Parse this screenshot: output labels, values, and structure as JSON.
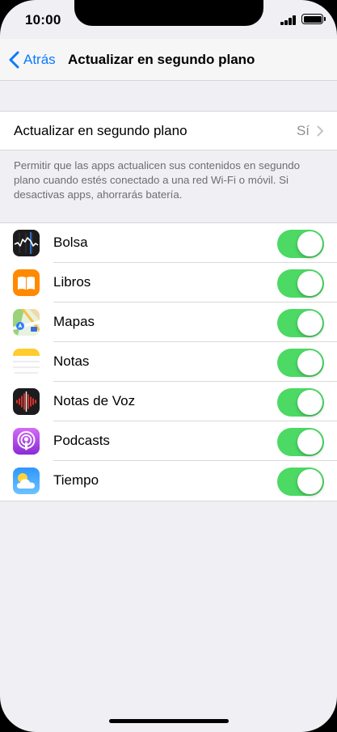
{
  "status_bar": {
    "time": "10:00"
  },
  "nav": {
    "back_label": "Atrás",
    "title": "Actualizar en segundo plano"
  },
  "main_setting": {
    "label": "Actualizar en segundo plano",
    "value": "Sí"
  },
  "footnote": "Permitir que las apps actualicen sus contenidos en segundo plano cuando estés conectado a una red Wi-Fi o móvil. Si desactivas apps, ahorrarás batería.",
  "apps": [
    {
      "name": "Bolsa",
      "icon": "stocks-icon",
      "enabled": true
    },
    {
      "name": "Libros",
      "icon": "books-icon",
      "enabled": true
    },
    {
      "name": "Mapas",
      "icon": "maps-icon",
      "enabled": true
    },
    {
      "name": "Notas",
      "icon": "notes-icon",
      "enabled": true
    },
    {
      "name": "Notas de Voz",
      "icon": "voice-memos-icon",
      "enabled": true
    },
    {
      "name": "Podcasts",
      "icon": "podcasts-icon",
      "enabled": true
    },
    {
      "name": "Tiempo",
      "icon": "weather-icon",
      "enabled": true
    }
  ],
  "colors": {
    "accent": "#0a7aff",
    "toggle_on": "#4cd964",
    "background": "#efeff4"
  }
}
